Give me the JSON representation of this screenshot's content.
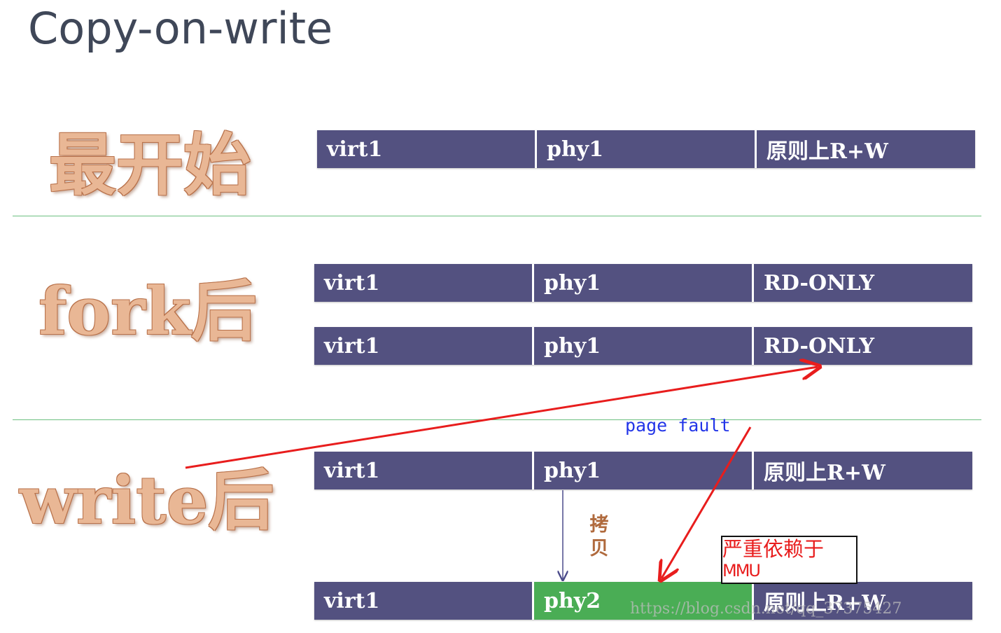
{
  "title": "Copy-on-write",
  "stages": {
    "initial": "最开始",
    "after_fork": "fork后",
    "after_write": "write后"
  },
  "rows": {
    "initial": {
      "virt": "virt1",
      "phys": "phy1",
      "perm": "原则上R+W"
    },
    "fork_parent": {
      "virt": "virt1",
      "phys": "phy1",
      "perm": "RD-ONLY"
    },
    "fork_child": {
      "virt": "virt1",
      "phys": "phy1",
      "perm": "RD-ONLY"
    },
    "write_original": {
      "virt": "virt1",
      "phys": "phy1",
      "perm": "原则上R+W"
    },
    "write_copy": {
      "virt": "virt1",
      "phys": "phy2",
      "perm": "原则上R+W"
    }
  },
  "annotations": {
    "copy_line1": "拷",
    "copy_line2": "贝",
    "page_fault": "page fault",
    "mmu_line1": "严重依赖于",
    "mmu_line2": "MMU",
    "watermark": "https://blog.csdn.net/qq_37375427"
  },
  "colors": {
    "cell_bg": "#535180",
    "highlight_bg": "#4aad55",
    "arrow_red": "#e81d1d",
    "arrow_blue": "#4a4a8a",
    "stage_text": "#e9b795",
    "divider": "#6cc080"
  }
}
